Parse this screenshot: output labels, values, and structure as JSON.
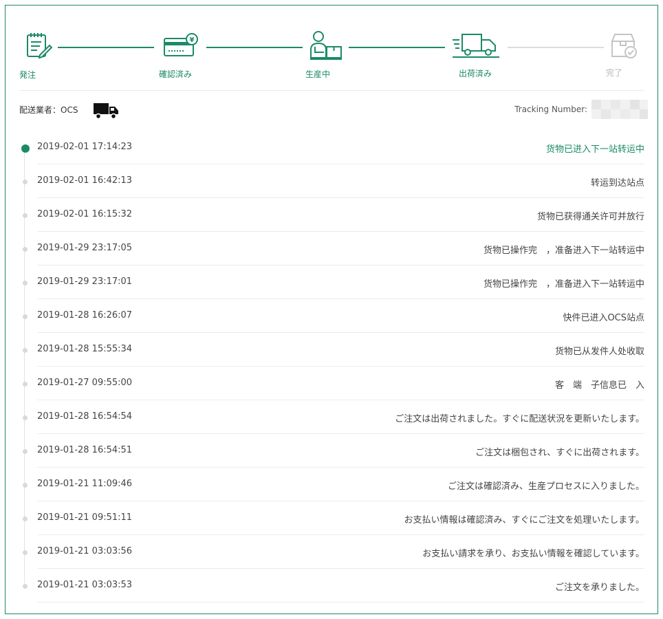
{
  "colors": {
    "accent": "#1a8a67",
    "inactive": "#b5b5b5"
  },
  "steps": [
    {
      "label": "発注",
      "icon": "order-form-icon",
      "active": true
    },
    {
      "label": "確認済み",
      "icon": "payment-card-icon",
      "active": true
    },
    {
      "label": "生産中",
      "icon": "worker-package-icon",
      "active": true
    },
    {
      "label": "出荷済み",
      "icon": "delivery-truck-icon",
      "active": true
    },
    {
      "label": "完了",
      "icon": "box-check-icon",
      "active": false
    }
  ],
  "carrier": {
    "label": "配送業者：OCS",
    "icon": "truck-icon",
    "tracking_label": "Tracking Number:"
  },
  "events": [
    {
      "time": "2019-02-01 17:14:23",
      "description": "货物已进入下一站转运中",
      "current": true
    },
    {
      "time": "2019-02-01 16:42:13",
      "description": "转运到达站点"
    },
    {
      "time": "2019-02-01 16:15:32",
      "description": "货物已获得通关许可并放行"
    },
    {
      "time": "2019-01-29 23:17:05",
      "description": "货物已操作完　，准备进入下一站转运中"
    },
    {
      "time": "2019-01-29 23:17:01",
      "description": "货物已操作完　，准备进入下一站转运中"
    },
    {
      "time": "2019-01-28 16:26:07",
      "description": "快件已进入OCS站点"
    },
    {
      "time": "2019-01-28 15:55:34",
      "description": "货物已从发件人处收取"
    },
    {
      "time": "2019-01-27 09:55:00",
      "description": "客　端　子信息已　入"
    },
    {
      "time": "2019-01-28 16:54:54",
      "description": "ご注文は出荷されました。すぐに配送状況を更新いたします。"
    },
    {
      "time": "2019-01-28 16:54:51",
      "description": "ご注文は梱包され、すぐに出荷されます。"
    },
    {
      "time": "2019-01-21 11:09:46",
      "description": "ご注文は確認済み、生産プロセスに入りました。"
    },
    {
      "time": "2019-01-21 09:51:11",
      "description": "お支払い情報は確認済み、すぐにご注文を処理いたします。"
    },
    {
      "time": "2019-01-21 03:03:56",
      "description": "お支払い請求を承り、お支払い情報を確認しています。"
    },
    {
      "time": "2019-01-21 03:03:53",
      "description": "ご注文を承りました。"
    }
  ]
}
